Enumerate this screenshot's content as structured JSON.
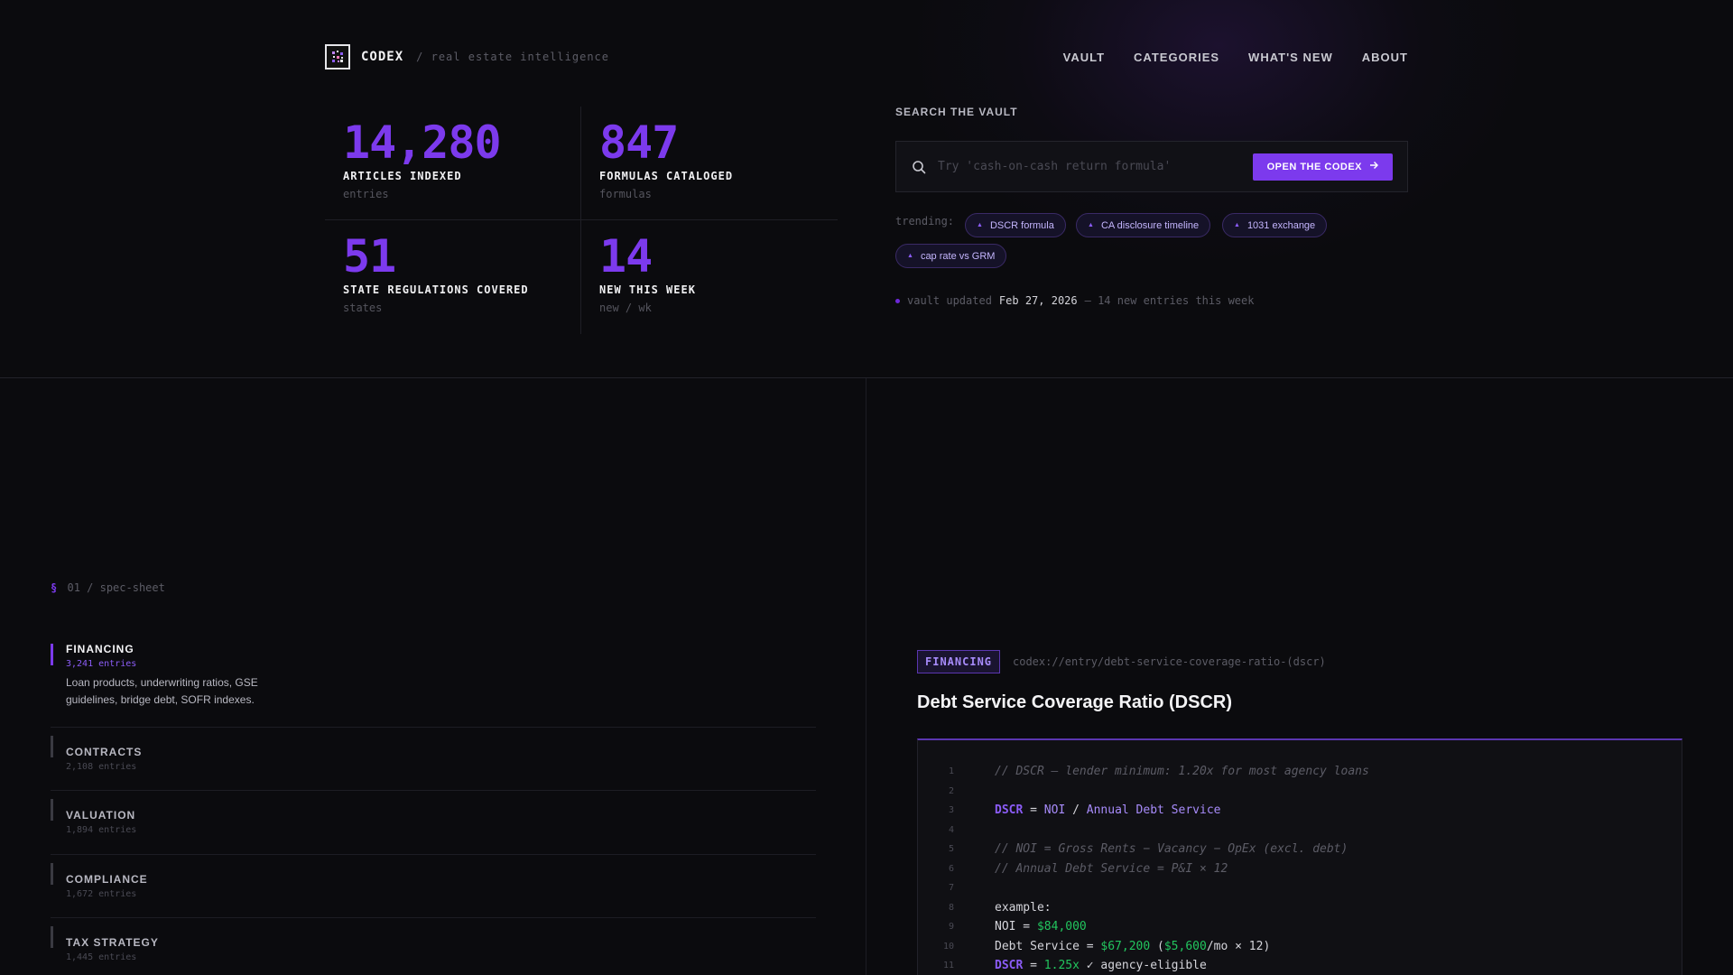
{
  "brand": {
    "name": "CODEX",
    "tagline": "/ real estate intelligence"
  },
  "nav": [
    {
      "label": "VAULT"
    },
    {
      "label": "CATEGORIES"
    },
    {
      "label": "WHAT'S NEW"
    },
    {
      "label": "ABOUT"
    }
  ],
  "stats": [
    {
      "value": "14,280",
      "label": "ARTICLES INDEXED",
      "unit": "entries"
    },
    {
      "value": "847",
      "label": "FORMULAS CATALOGED",
      "unit": "formulas"
    },
    {
      "value": "51",
      "label": "STATE REGULATIONS COVERED",
      "unit": "states"
    },
    {
      "value": "14",
      "label": "NEW THIS WEEK",
      "unit": "new / wk"
    }
  ],
  "search": {
    "title": "SEARCH THE VAULT",
    "placeholder": "Try 'cash-on-cash return formula'",
    "button_label": "OPEN THE CODEX",
    "trending_label": "trending:",
    "trending": [
      "DSCR formula",
      "CA disclosure timeline",
      "1031 exchange",
      "cap rate vs GRM"
    ]
  },
  "updated": {
    "prefix": "vault updated",
    "date": "Feb 27, 2026",
    "suffix": "— 14 new entries this week"
  },
  "spec": {
    "section_mark": "§",
    "section_label": "01 / spec-sheet",
    "categories": [
      {
        "name": "FINANCING",
        "count": "3,241 entries",
        "desc": "Loan products, underwriting ratios, GSE guidelines, bridge debt, SOFR indexes."
      },
      {
        "name": "CONTRACTS",
        "count": "2,108 entries"
      },
      {
        "name": "VALUATION",
        "count": "1,894 entries"
      },
      {
        "name": "COMPLIANCE",
        "count": "1,672 entries"
      },
      {
        "name": "TAX STRATEGY",
        "count": "1,445 entries"
      }
    ]
  },
  "entry": {
    "badge": "FINANCING",
    "path": "codex://entry/debt-service-coverage-ratio-(dscr)",
    "title": "Debt Service Coverage Ratio (DSCR)",
    "code_lines": [
      {
        "n": "1",
        "parts": [
          {
            "t": "// DSCR — lender minimum: 1.20x for most agency loans",
            "c": "c-com"
          }
        ]
      },
      {
        "n": "2",
        "parts": []
      },
      {
        "n": "3",
        "parts": [
          {
            "t": "DSCR",
            "c": "c-kw"
          },
          {
            "t": " = ",
            "c": "c-plain"
          },
          {
            "t": "NOI",
            "c": "c-var"
          },
          {
            "t": " / ",
            "c": "c-plain"
          },
          {
            "t": "Annual Debt Service",
            "c": "c-var"
          }
        ]
      },
      {
        "n": "4",
        "parts": []
      },
      {
        "n": "5",
        "parts": [
          {
            "t": "// NOI = Gross Rents − Vacancy − OpEx (excl. debt)",
            "c": "c-com"
          }
        ]
      },
      {
        "n": "6",
        "parts": [
          {
            "t": "// Annual Debt Service = P&I × 12",
            "c": "c-com"
          }
        ]
      },
      {
        "n": "7",
        "parts": []
      },
      {
        "n": "8",
        "parts": [
          {
            "t": "example:",
            "c": "c-plain"
          }
        ]
      },
      {
        "n": "9",
        "parts": [
          {
            "t": "NOI = ",
            "c": "c-plain"
          },
          {
            "t": "$84,000",
            "c": "c-num"
          }
        ]
      },
      {
        "n": "10",
        "parts": [
          {
            "t": "Debt Service = ",
            "c": "c-plain"
          },
          {
            "t": "$67,200",
            "c": "c-num"
          },
          {
            "t": " (",
            "c": "c-plain"
          },
          {
            "t": "$5,600",
            "c": "c-num"
          },
          {
            "t": "/mo × 12)",
            "c": "c-plain"
          }
        ]
      },
      {
        "n": "11",
        "parts": [
          {
            "t": "DSCR",
            "c": "c-kw"
          },
          {
            "t": " = ",
            "c": "c-plain"
          },
          {
            "t": "1.25x",
            "c": "c-num"
          },
          {
            "t": " ✓ agency-eligible",
            "c": "c-plain"
          }
        ]
      }
    ]
  },
  "colors": {
    "accent": "#7c3aed",
    "positive": "#22c55e",
    "background": "#0b0b0e"
  }
}
